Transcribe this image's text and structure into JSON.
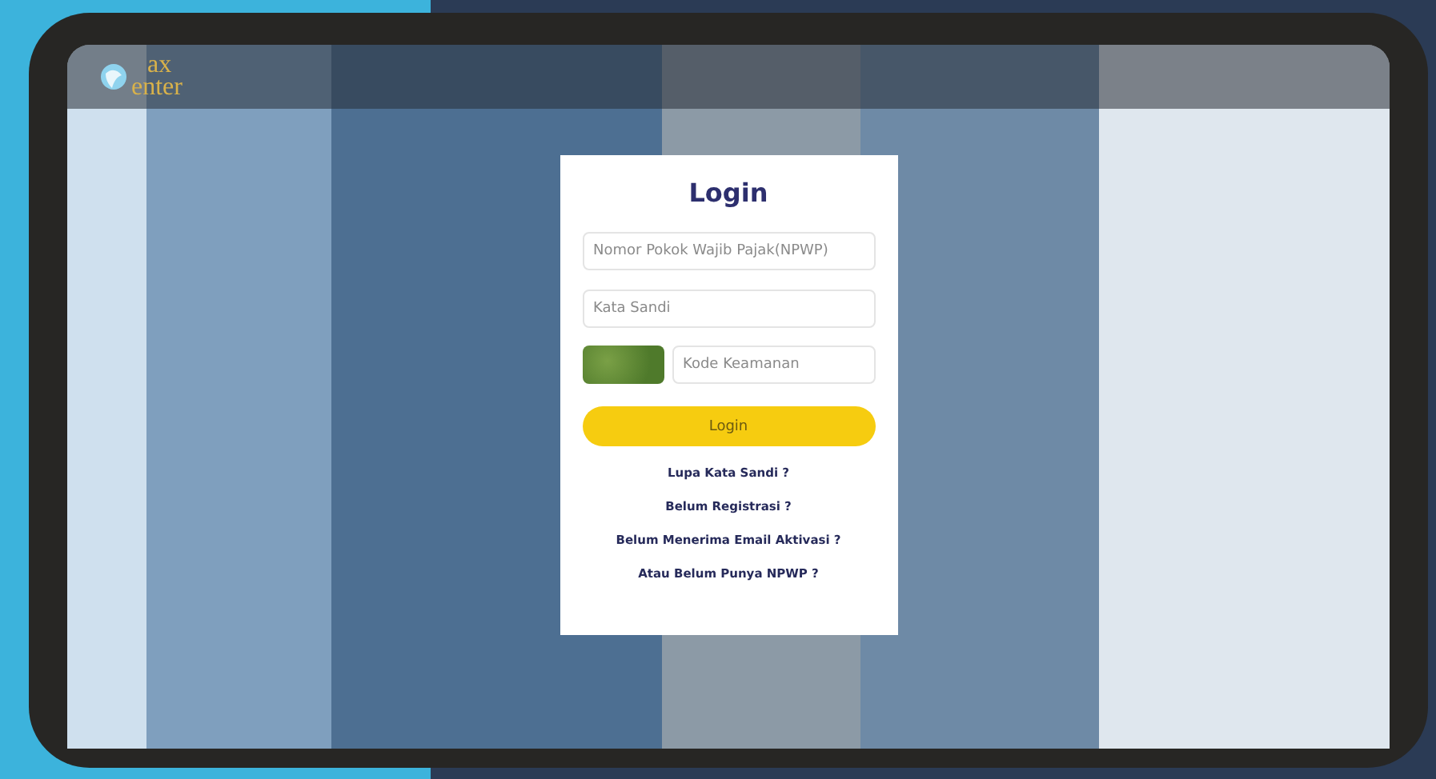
{
  "logo": {
    "line_1": "ax",
    "line_2": "enter"
  },
  "login_card": {
    "title": "Login",
    "fields": [
      {
        "placeholder": "Nomor Pokok Wajib Pajak(NPWP)"
      },
      {
        "placeholder": "Kata Sandi"
      }
    ],
    "captcha": {
      "placeholder": "Kode Keamanan"
    },
    "button": "Login",
    "links": [
      "Lupa Kata Sandi ?",
      "Belum Registrasi ?",
      "Belum Menerima Email Aktivasi ?",
      "Atau Belum Punya NPWP ?"
    ]
  }
}
